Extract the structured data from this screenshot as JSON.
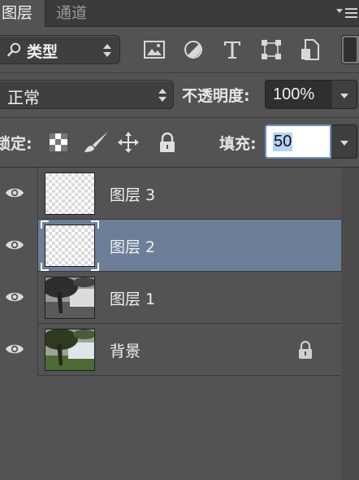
{
  "tabs": [
    {
      "label": "图层",
      "active": true
    },
    {
      "label": "通道",
      "active": false
    }
  ],
  "filter": {
    "kind_label": "类型",
    "icons": [
      "image-filter-icon",
      "adjustment-filter-icon",
      "type-filter-icon",
      "shape-filter-icon",
      "smart-object-filter-icon"
    ]
  },
  "blend": {
    "mode": "正常",
    "opacity_label": "不透明度:",
    "opacity_value": "100%"
  },
  "lock": {
    "label": "锁定:",
    "icons": [
      "lock-transparent-pixels-icon",
      "lock-image-pixels-icon",
      "lock-position-icon",
      "lock-all-icon"
    ],
    "fill_label": "填充:",
    "fill_value": "50"
  },
  "layers": [
    {
      "name": "图层 3",
      "thumb": "transparent",
      "selected": false,
      "locked": false
    },
    {
      "name": "图层 2",
      "thumb": "transparent",
      "selected": true,
      "locked": false
    },
    {
      "name": "图层 1",
      "thumb": "photo-grayscale",
      "selected": false,
      "locked": false
    },
    {
      "name": "背景",
      "thumb": "photo-color",
      "selected": false,
      "locked": true
    }
  ],
  "colors": {
    "panel_bg": "#535353",
    "selected_row": "#6d7f98",
    "field_focus": "#6c8fc4"
  }
}
